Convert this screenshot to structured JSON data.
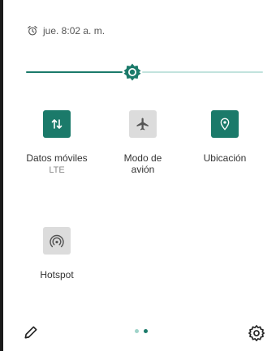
{
  "status": {
    "alarm_icon": "alarm-clock-icon",
    "alarm_text": "jue. 8:02 a. m."
  },
  "brightness": {
    "level": 0.45,
    "accent_color": "#1b7a6a",
    "track_color": "#c2e3dd",
    "thumb_icon": "brightness-icon"
  },
  "tiles": [
    {
      "id": "mobile-data",
      "label": "Datos móviles",
      "sublabel": "LTE",
      "icon": "mobile-data-arrows-icon",
      "state": "on"
    },
    {
      "id": "airplane",
      "label": "Modo de\navión",
      "sublabel": "",
      "icon": "airplane-icon",
      "state": "off"
    },
    {
      "id": "location",
      "label": "Ubicación",
      "sublabel": "",
      "icon": "location-pin-icon",
      "state": "on"
    },
    {
      "id": "hotspot",
      "label": "Hotspot",
      "sublabel": "",
      "icon": "hotspot-icon",
      "state": "off"
    }
  ],
  "footer": {
    "edit_icon": "pencil-icon",
    "pages": {
      "count": 2,
      "current": 2
    },
    "settings_icon": "gear-icon"
  }
}
